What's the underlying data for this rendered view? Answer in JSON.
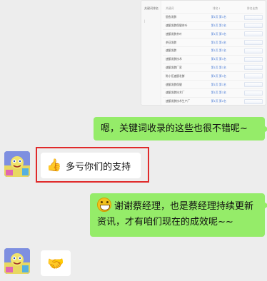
{
  "shared_image": {
    "side_label": "关键词排名",
    "side_mark": "|",
    "headers": [
      "关键词",
      "排名↓",
      "排名走势"
    ],
    "rows": [
      {
        "keyword": "银杏发酵",
        "rank": "第1页 第1名"
      },
      {
        "keyword": "速酿发酵保健茶叶",
        "rank": "第1页 第2名"
      },
      {
        "keyword": "速酿发酵茶叶",
        "rank": "第1页 第3名"
      },
      {
        "keyword": "茶苷发酵",
        "rank": "第1页 第4名"
      },
      {
        "keyword": "速酿发酵",
        "rank": "第1页 第1名"
      },
      {
        "keyword": "速酿发酵技术",
        "rank": "第1页 第1名"
      },
      {
        "keyword": "速酿发酵厂家",
        "rank": "第1页 第1名"
      },
      {
        "keyword": "陈小伍速酿发酵",
        "rank": "第1页 第1名"
      },
      {
        "keyword": "速酿发酵保健",
        "rank": "第1页 第1名"
      },
      {
        "keyword": "速酿发酵技术厂",
        "rank": "第1页 第1名"
      },
      {
        "keyword": "速酿发酵技术生产厂",
        "rank": "第1页 第2名"
      }
    ]
  },
  "messages": {
    "m1": "嗯，关键词收录的这些也很不错呢~",
    "m2": "多亏你们的支持",
    "m3": "谢谢蔡经理，也是蔡经理持续更新资讯，才有咱们现在的成效呢~~"
  },
  "icons": {
    "thumb": "thumbs-up-icon",
    "grin": "grinning-emoji-icon",
    "handshake": "handshake-icon"
  },
  "colors": {
    "bg": "#ededed",
    "green_bubble": "#95ec69",
    "highlight": "#e02a2a"
  }
}
